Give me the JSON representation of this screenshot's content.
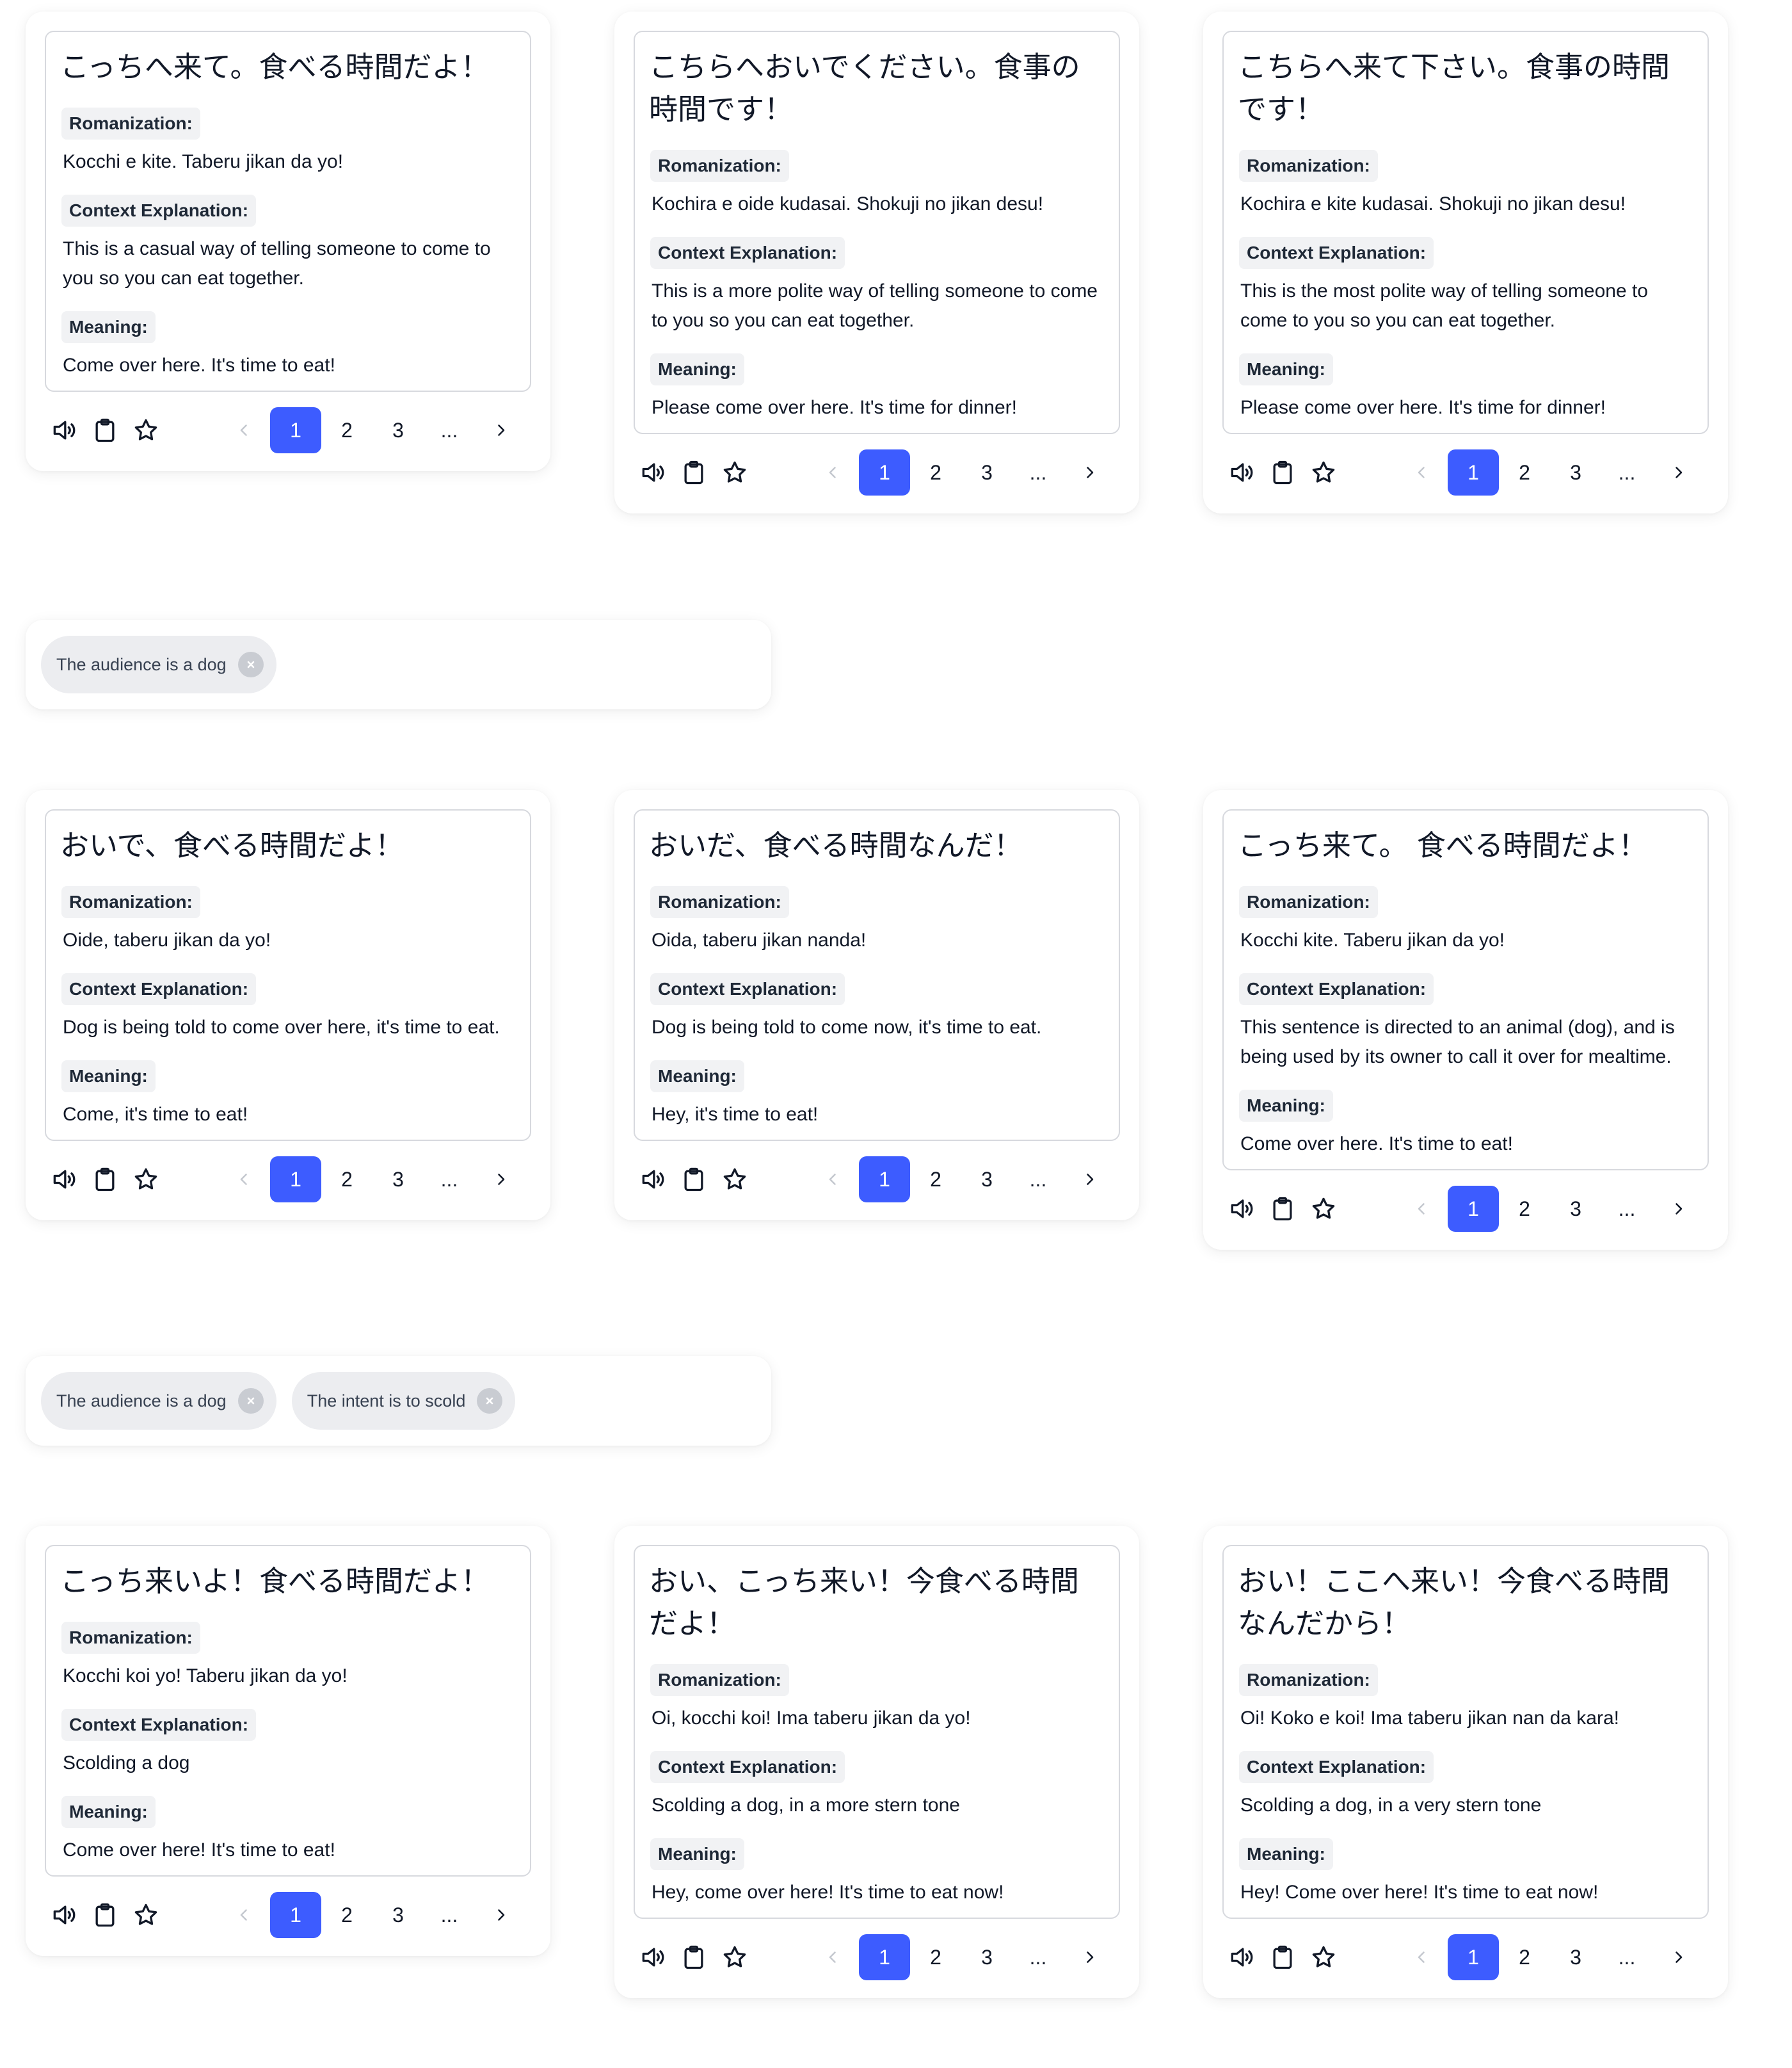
{
  "cards": [
    {
      "japanese": "こっちへ来て。食べる時間だよ！",
      "romanization": "Kocchi e kite. Taberu jikan da yo!",
      "context": "This is a casual way of telling someone to come to you so you can eat together.",
      "meaning": "Come over here. It's time to eat!"
    },
    {
      "japanese": "こちらへおいでください。食事の時間です！",
      "romanization": "Kochira e oide kudasai. Shokuji no jikan desu!",
      "context": "This is a more polite way of telling someone to come to you so you can eat together.",
      "meaning": "Please come over here. It's time for dinner!"
    },
    {
      "japanese": "こちらへ来て下さい。食事の時間です！",
      "romanization": "Kochira e kite kudasai. Shokuji no jikan desu!",
      "context": "This is the most polite way of telling someone to come to you so you can eat together.",
      "meaning": "Please come over here. It's time for dinner!"
    },
    {
      "japanese": "おいで、食べる時間だよ！",
      "romanization": "Oide, taberu jikan da yo!",
      "context": "Dog is being told to come over here, it's time to eat.",
      "meaning": "Come, it's time to eat!"
    },
    {
      "japanese": "おいだ、食べる時間なんだ！",
      "romanization": "Oida, taberu jikan nanda!",
      "context": "Dog is being told to come now, it's time to eat.",
      "meaning": "Hey, it's time to eat!"
    },
    {
      "japanese": "こっち来て。 食べる時間だよ！",
      "romanization": "Kocchi kite. Taberu jikan da yo!",
      "context": "This sentence is directed to an animal (dog), and is being used by its owner to call it over for mealtime.",
      "meaning": "Come over here. It's time to eat!"
    },
    {
      "japanese": "こっち来いよ！食べる時間だよ！",
      "romanization": "Kocchi koi yo! Taberu jikan da yo!",
      "context": "Scolding a dog",
      "meaning": "Come over here! It's time to eat!"
    },
    {
      "japanese": "おい、こっち来い！今食べる時間だよ！",
      "romanization": "Oi, kocchi koi! Ima taberu jikan da yo!",
      "context": "Scolding a dog, in a more stern tone",
      "meaning": "Hey, come over here! It's time to eat now!"
    },
    {
      "japanese": "おい！ここへ来い！今食べる時間なんだから！",
      "romanization": "Oi! Koko e koi! Ima taberu jikan nan da kara!",
      "context": "Scolding a dog, in a very stern tone",
      "meaning": "Hey! Come over here! It's time to eat now!"
    }
  ],
  "labels": {
    "romanization": "Romanization:",
    "context": "Context Explanation:",
    "meaning": "Meaning:"
  },
  "pagination": {
    "pages": [
      "1",
      "2",
      "3",
      "..."
    ],
    "current": "1"
  },
  "icons": {
    "speaker": "speaker-icon",
    "clipboard": "clipboard-icon",
    "star": "star-icon",
    "prev": "chevron-left-icon",
    "next": "chevron-right-icon",
    "remove": "close-icon"
  },
  "tag_groups": [
    {
      "tags": [
        "The audience is a dog"
      ]
    },
    {
      "tags": [
        "The audience is a dog",
        "The intent is to scold"
      ]
    }
  ],
  "colors": {
    "accent": "#3d5cff",
    "label_bg": "#f1f2f4",
    "chip_bg": "#ecedf0"
  }
}
